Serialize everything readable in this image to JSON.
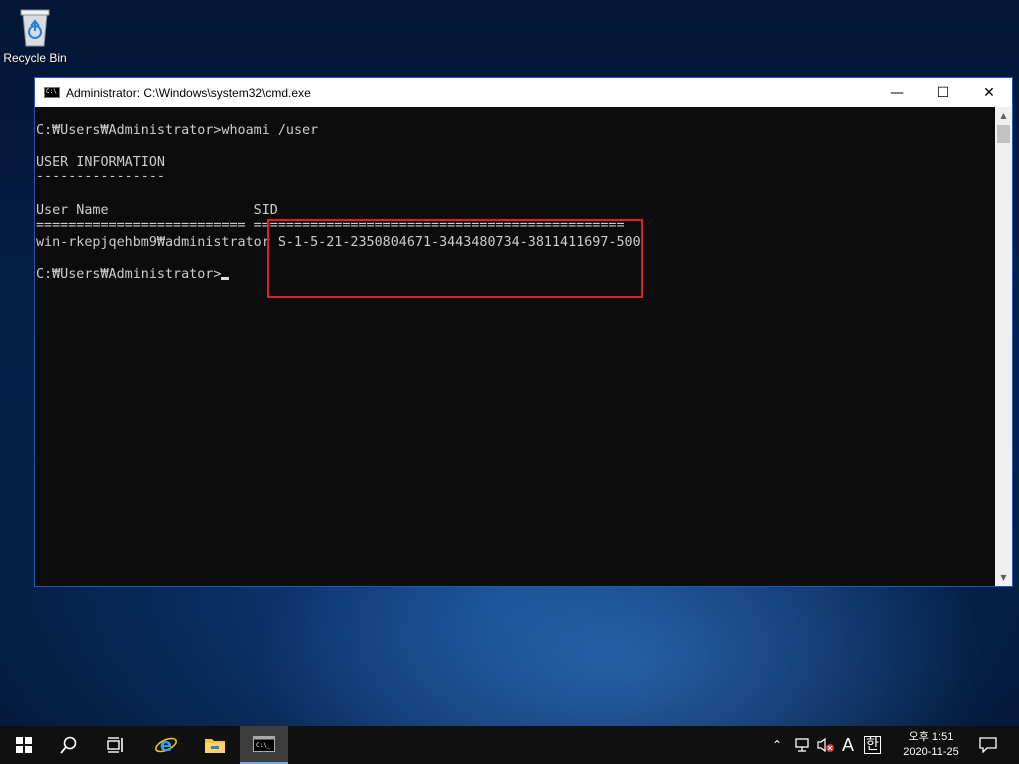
{
  "desktop": {
    "recycle_bin_label": "Recycle Bin"
  },
  "window": {
    "title": "Administrator: C:\\Windows\\system32\\cmd.exe",
    "controls": {
      "minimize": "—",
      "maximize": "☐",
      "close": "✕"
    }
  },
  "console": {
    "lines": [
      "C:₩Users₩Administrator>whoami /user",
      "USER INFORMATION",
      "----------------",
      "User Name                  SID",
      "========================== ==============================================",
      "win-rkepjqehbm9₩administrator S-1-5-21-2350804671-3443480734-3811411697-500",
      "C:₩Users₩Administrator>"
    ]
  },
  "taskbar": {
    "time": "오후 1:51",
    "date": "2020-11-25",
    "ime_a": "A",
    "ime_han": "한"
  },
  "colors": {
    "highlight_box": "#e02020",
    "console_bg": "#0c0c0c",
    "console_text": "#cccccc"
  }
}
